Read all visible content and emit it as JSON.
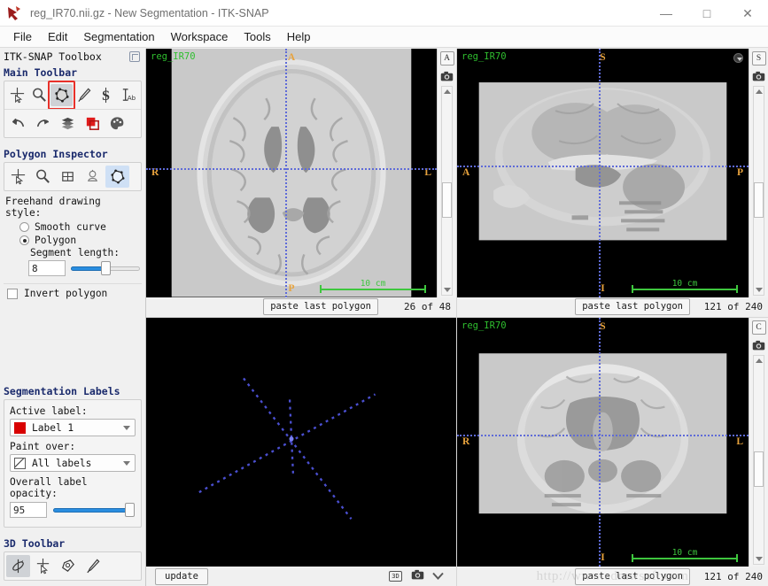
{
  "window": {
    "title": "reg_IR70.nii.gz - New Segmentation - ITK-SNAP",
    "app_icon": "snap-logo-icon",
    "minimize": "—",
    "maximize": "□",
    "close": "✕"
  },
  "menubar": {
    "items": [
      {
        "label": "File"
      },
      {
        "label": "Edit"
      },
      {
        "label": "Segmentation"
      },
      {
        "label": "Workspace"
      },
      {
        "label": "Tools"
      },
      {
        "label": "Help"
      }
    ]
  },
  "toolbox": {
    "header": "ITK-SNAP Toolbox",
    "undock_icon": "undock-icon",
    "main_toolbar": {
      "title": "Main Toolbar",
      "row1": [
        {
          "name": "crosshair-tool",
          "icon": "crosshair-cursor-icon",
          "selected": false
        },
        {
          "name": "zoom-pan-tool",
          "icon": "magnifier-icon",
          "selected": false
        },
        {
          "name": "polygon-tool",
          "icon": "polygon-icon",
          "selected": true,
          "highlight": true
        },
        {
          "name": "paintbrush-tool",
          "icon": "paintbrush-icon",
          "selected": false
        },
        {
          "name": "snake-tool",
          "icon": "snake-s-icon",
          "selected": false
        },
        {
          "name": "annotation-tool",
          "icon": "ruler-ab-icon",
          "selected": false
        }
      ],
      "row2": [
        {
          "name": "undo-button",
          "icon": "undo-arrow-icon"
        },
        {
          "name": "redo-button",
          "icon": "redo-arrow-icon"
        },
        {
          "name": "layer-inspector-button",
          "icon": "layers-icon"
        },
        {
          "name": "label-editor-button",
          "icon": "red-squares-icon"
        },
        {
          "name": "appearance-button",
          "icon": "palette-icon"
        }
      ]
    },
    "polygon_inspector": {
      "title": "Polygon Inspector",
      "tabs": [
        {
          "name": "tab-crosshair",
          "icon": "crosshair-cursor-icon",
          "selected": false
        },
        {
          "name": "tab-zoom",
          "icon": "magnifier-icon",
          "selected": false
        },
        {
          "name": "tab-grid",
          "icon": "grid-icon",
          "selected": false
        },
        {
          "name": "tab-snake",
          "icon": "snake-head-icon",
          "selected": false
        },
        {
          "name": "tab-polygon",
          "icon": "polygon-icon",
          "selected": true
        }
      ],
      "freehand_label": "Freehand drawing style:",
      "options": [
        {
          "label": "Smooth curve",
          "checked": false
        },
        {
          "label": "Polygon",
          "checked": true
        }
      ],
      "segment_length_label": "Segment length:",
      "segment_length_value": "8",
      "segment_length_percent": 47,
      "invert_polygon_label": "Invert polygon",
      "invert_polygon_checked": false
    },
    "segmentation_labels": {
      "title": "Segmentation Labels",
      "active_label_caption": "Active label:",
      "active_label_value": "Label 1",
      "active_label_color": "#d80000",
      "paint_over_caption": "Paint over:",
      "paint_over_value": "All labels",
      "opacity_caption": "Overall label opacity:",
      "opacity_value": "95",
      "opacity_percent": 95
    },
    "toolbar_3d": {
      "title": "3D Toolbar",
      "buttons": [
        {
          "name": "trackball-tool",
          "icon": "trackball-icon",
          "selected": true
        },
        {
          "name": "crosshair-3d-tool",
          "icon": "crosshair-cursor-icon",
          "selected": false
        },
        {
          "name": "spray-tool",
          "icon": "spraypaint-icon",
          "selected": false
        },
        {
          "name": "scalpel-tool",
          "icon": "scalpel-icon",
          "selected": false
        }
      ]
    }
  },
  "views": {
    "axial": {
      "layer_name": "reg_IR70",
      "plane_letter": "A",
      "orientation": {
        "top": "A",
        "bottom": "P",
        "left": "R",
        "right": "L"
      },
      "scale_text": "10 cm",
      "paste_button": "paste last polygon",
      "slice_counter": "26 of 48",
      "camera_icon": "camera-icon"
    },
    "sagittal": {
      "layer_name": "reg_IR70",
      "plane_letter": "S",
      "orientation": {
        "top": "S",
        "bottom": "I",
        "left": "A",
        "right": "P"
      },
      "scale_text": "10 cm",
      "paste_button": "paste last polygon",
      "slice_counter": "121 of 240",
      "camera_icon": "camera-icon",
      "close_icon": "collapse-icon"
    },
    "threeD": {
      "update_button": "update",
      "icon_3d": "3D",
      "camera_icon": "camera-icon",
      "chevron_icon": "chevron-down-icon"
    },
    "coronal": {
      "layer_name": "reg_IR70",
      "plane_letter": "C",
      "orientation": {
        "top": "S",
        "bottom": "I",
        "left": "R",
        "right": "L"
      },
      "scale_text": "10 cm",
      "paste_button": "paste last polygon",
      "slice_counter": "121 of 240",
      "camera_icon": "camera-icon"
    }
  },
  "watermark": "http://www.edrawsoft.com"
}
